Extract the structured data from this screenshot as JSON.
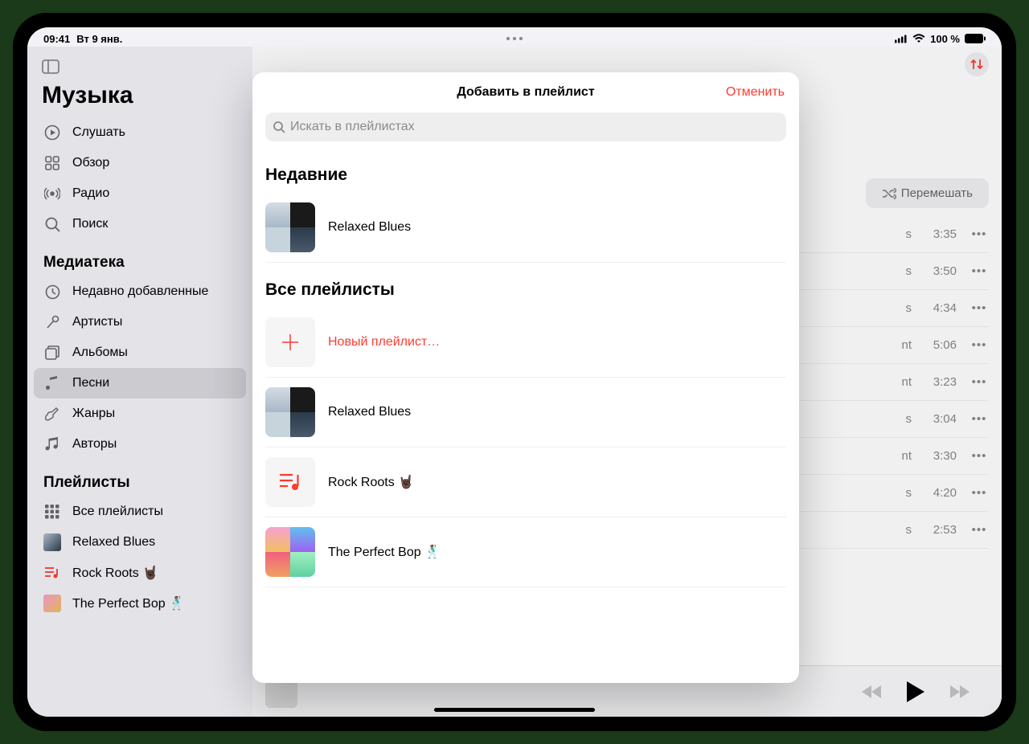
{
  "status": {
    "time": "09:41",
    "date": "Вт 9 янв.",
    "battery": "100 %"
  },
  "app_title": "Музыка",
  "sidebar": {
    "nav": [
      {
        "label": "Слушать",
        "icon": "play-circle"
      },
      {
        "label": "Обзор",
        "icon": "grid"
      },
      {
        "label": "Радио",
        "icon": "radio"
      },
      {
        "label": "Поиск",
        "icon": "search"
      }
    ],
    "library_title": "Медиатека",
    "library": [
      {
        "label": "Недавно добавленные",
        "icon": "clock"
      },
      {
        "label": "Артисты",
        "icon": "mic"
      },
      {
        "label": "Альбомы",
        "icon": "album"
      },
      {
        "label": "Песни",
        "icon": "note",
        "active": true
      },
      {
        "label": "Жанры",
        "icon": "guitar"
      },
      {
        "label": "Авторы",
        "icon": "notes"
      }
    ],
    "playlists_title": "Плейлисты",
    "playlists": [
      {
        "label": "Все плейлисты",
        "icon": "grid3"
      },
      {
        "label": "Relaxed Blues",
        "icon": "thumb"
      },
      {
        "label": "Rock Roots 🤘🏿",
        "icon": "playlist"
      },
      {
        "label": "The Perfect Bop 🕺🏽",
        "icon": "thumb-pink"
      }
    ]
  },
  "content": {
    "shuffle_label": "Перемешать",
    "songs": [
      {
        "tail": "s",
        "time": "3:35"
      },
      {
        "tail": "s",
        "time": "3:50"
      },
      {
        "tail": "s",
        "time": "4:34"
      },
      {
        "tail": "nt",
        "time": "5:06"
      },
      {
        "tail": "nt",
        "time": "3:23"
      },
      {
        "tail": "s",
        "time": "3:04"
      },
      {
        "tail": "nt",
        "time": "3:30"
      },
      {
        "tail": "s",
        "time": "4:20"
      },
      {
        "tail": "s",
        "time": "2:53"
      }
    ]
  },
  "modal": {
    "title": "Добавить в плейлист",
    "cancel": "Отменить",
    "search_placeholder": "Искать в плейлистах",
    "recent_title": "Недавние",
    "recent": [
      {
        "label": "Relaxed Blues",
        "art": "relaxed"
      }
    ],
    "all_title": "Все плейлисты",
    "new_label": "Новый плейлист…",
    "all": [
      {
        "label": "Relaxed Blues",
        "art": "relaxed"
      },
      {
        "label": "Rock Roots 🤘🏿",
        "art": "rock"
      },
      {
        "label": "The Perfect Bop 🕺🏽",
        "art": "bop"
      }
    ]
  }
}
